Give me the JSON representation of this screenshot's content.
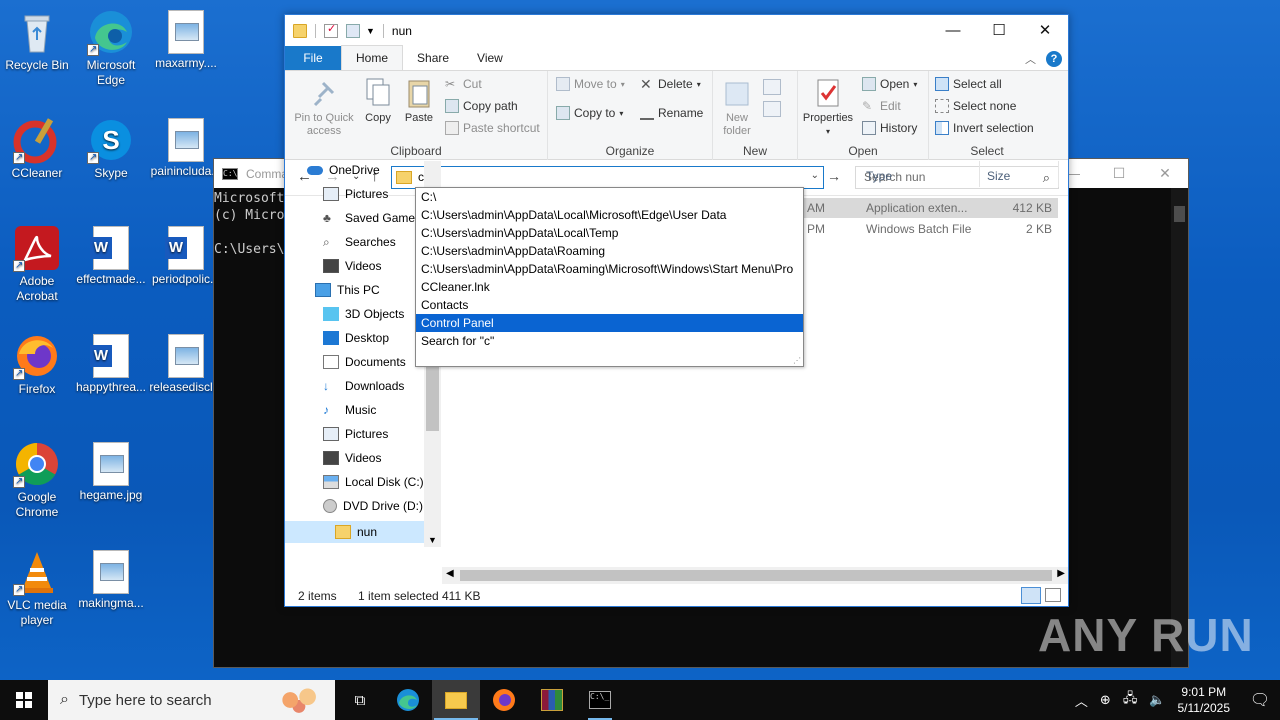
{
  "desktop": {
    "icons": [
      {
        "label": "Recycle Bin"
      },
      {
        "label": "Microsoft Edge"
      },
      {
        "label": "maxarmy...."
      },
      {
        "label": "CCleaner"
      },
      {
        "label": "Skype"
      },
      {
        "label": "painincluda..."
      },
      {
        "label": "Adobe Acrobat"
      },
      {
        "label": "effectmade..."
      },
      {
        "label": "periodpolic..."
      },
      {
        "label": "Firefox"
      },
      {
        "label": "happythrea..."
      },
      {
        "label": "releasediscl..."
      },
      {
        "label": "Google Chrome"
      },
      {
        "label": "hegame.jpg"
      },
      {
        "label": "VLC media player"
      },
      {
        "label": "makingma..."
      }
    ]
  },
  "cmd": {
    "title": "Comma",
    "lines": "Microsoft\n(c) Micro\n\nC:\\Users\\"
  },
  "explorer": {
    "title": "nun",
    "tabs": {
      "file": "File",
      "home": "Home",
      "share": "Share",
      "view": "View"
    },
    "ribbon": {
      "clipboard": {
        "label": "Clipboard",
        "pin": "Pin to Quick access",
        "copy": "Copy",
        "paste": "Paste",
        "cut": "Cut",
        "copy_path": "Copy path",
        "paste_shortcut": "Paste shortcut"
      },
      "organize": {
        "label": "Organize",
        "move_to": "Move to",
        "copy_to": "Copy to",
        "delete": "Delete",
        "rename": "Rename"
      },
      "new": {
        "label": "New",
        "new_folder": "New folder"
      },
      "open": {
        "label": "Open",
        "properties": "Properties",
        "open": "Open",
        "edit": "Edit",
        "history": "History"
      },
      "select": {
        "label": "Select",
        "select_all": "Select all",
        "select_none": "Select none",
        "invert": "Invert selection"
      }
    },
    "address": {
      "value": "c",
      "search_placeholder": "Search nun"
    },
    "autocomplete": [
      "C:\\",
      "C:\\Users\\admin\\AppData\\Local\\Microsoft\\Edge\\User Data",
      "C:\\Users\\admin\\AppData\\Local\\Temp",
      "C:\\Users\\admin\\AppData\\Roaming",
      "C:\\Users\\admin\\AppData\\Roaming\\Microsoft\\Windows\\Start Menu\\Pro",
      "CCleaner.lnk",
      "Contacts",
      "Control Panel",
      "Search for \"c\""
    ],
    "nav_pane": [
      "OneDrive",
      "Pictures",
      "Saved Games",
      "Searches",
      "Videos",
      "This PC",
      "3D Objects",
      "Desktop",
      "Documents",
      "Downloads",
      "Music",
      "Pictures",
      "Videos",
      "Local Disk (C:)",
      "DVD Drive (D:)",
      "nun"
    ],
    "columns": {
      "type": "Type",
      "size": "Size"
    },
    "files": [
      {
        "date_tail": "AM",
        "type": "Application exten...",
        "size": "412 KB"
      },
      {
        "date_tail": "PM",
        "type": "Windows Batch File",
        "size": "2 KB"
      }
    ],
    "status": {
      "items": "2 items",
      "selected": "1 item selected",
      "size": "411 KB"
    }
  },
  "taskbar": {
    "search_placeholder": "Type here to search",
    "time": "9:01 PM",
    "date": "5/11/2025"
  },
  "watermark": "ANY RUN"
}
